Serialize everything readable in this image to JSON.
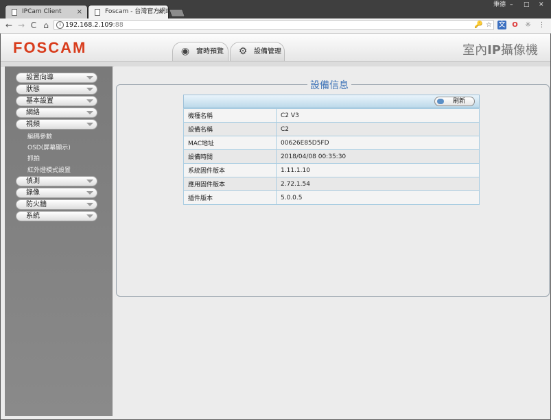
{
  "browser": {
    "tabs": [
      {
        "title": "IPCam Client",
        "close": "×"
      },
      {
        "title": "Foscam - 台灣官方網站",
        "close": "×"
      }
    ],
    "window_controls": {
      "user": "秉德",
      "minimize": "–",
      "maximize": "□",
      "close": "✕"
    },
    "nav": {
      "back": "←",
      "forward": "→",
      "reload": "C",
      "home": "⌂"
    },
    "address": {
      "host": "192.168.2.109",
      "port": ":88"
    },
    "toolbar_icons": {
      "key": "🔑",
      "star": "☆",
      "menu": "⋮"
    }
  },
  "header": {
    "logo": "FOSCAM",
    "nav_tabs": [
      {
        "label": "實時預覽",
        "icon": "camera-icon"
      },
      {
        "label": "設備管理",
        "icon": "gears-icon"
      }
    ],
    "product_prefix": "室內",
    "product_bold": "IP",
    "product_suffix": "攝像機"
  },
  "sidebar": {
    "menu_top": [
      {
        "label": "設置向導"
      },
      {
        "label": "狀態"
      },
      {
        "label": "基本設置"
      },
      {
        "label": "網絡"
      },
      {
        "label": "視頻"
      }
    ],
    "video_sub": [
      {
        "label": "編碼參數"
      },
      {
        "label": "OSD(屏幕顯示)"
      },
      {
        "label": "抓拍"
      },
      {
        "label": "紅外燈模式設置"
      }
    ],
    "menu_bottom": [
      {
        "label": "偵測"
      },
      {
        "label": "錄像"
      },
      {
        "label": "防火牆"
      },
      {
        "label": "系統"
      }
    ]
  },
  "panel": {
    "title": "設備信息",
    "refresh_label": "刷新",
    "rows": [
      {
        "key": "機種名稱",
        "value": "C2 V3"
      },
      {
        "key": "設備名稱",
        "value": "C2"
      },
      {
        "key": "MAC地址",
        "value": "00626E85D5FD"
      },
      {
        "key": "設備時間",
        "value": "2018/04/08 00:35:30"
      },
      {
        "key": "系統固件版本",
        "value": "1.11.1.10"
      },
      {
        "key": "應用固件版本",
        "value": "2.72.1.54"
      },
      {
        "key": "插件版本",
        "value": "5.0.0.5"
      }
    ]
  },
  "colors": {
    "logo": "#d83c1c",
    "title_blue": "#3f74b7",
    "sidebar": "#7a7a7a"
  }
}
